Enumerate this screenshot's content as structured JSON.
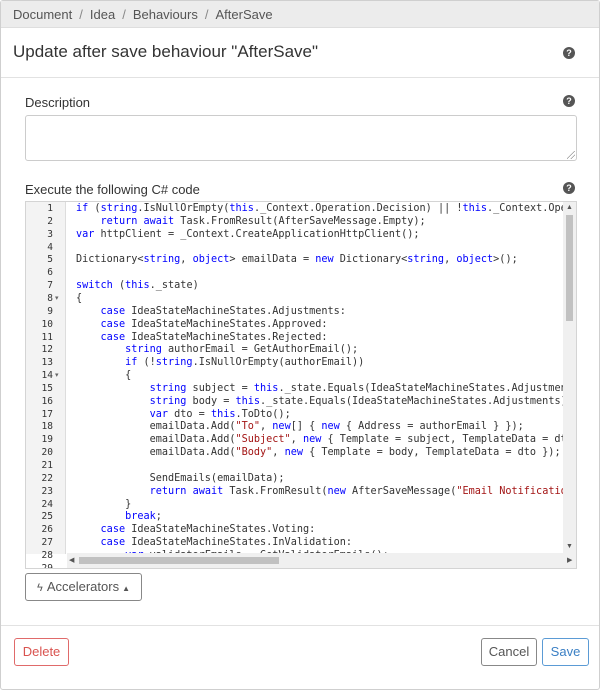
{
  "breadcrumb": [
    "Document",
    "Idea",
    "Behaviours",
    "AfterSave"
  ],
  "dialog": {
    "title": "Update after save behaviour \"AfterSave\""
  },
  "description": {
    "label": "Description",
    "value": ""
  },
  "code": {
    "label": "Execute the following C# code",
    "fold_lines": [
      8,
      14
    ],
    "lines": [
      "if (string.IsNullOrEmpty(this._Context.Operation.Decision) || !this._Context.Operation.",
      "    return await Task.FromResult(AfterSaveMessage.Empty);",
      "var httpClient = _Context.CreateApplicationHttpClient();",
      "",
      "Dictionary<string, object> emailData = new Dictionary<string, object>();",
      "",
      "switch (this._state)",
      "{",
      "    case IdeaStateMachineStates.Adjustments:",
      "    case IdeaStateMachineStates.Approved:",
      "    case IdeaStateMachineStates.Rejected:",
      "        string authorEmail = GetAuthorEmail();",
      "        if (!string.IsNullOrEmpty(authorEmail))",
      "        {",
      "            string subject = this._state.Equals(IdeaStateMachineStates.Adjustments) ?",
      "            string body = this._state.Equals(IdeaStateMachineStates.Adjustments) ? \"I",
      "            var dto = this.ToDto();",
      "            emailData.Add(\"To\", new[] { new { Address = authorEmail } });",
      "            emailData.Add(\"Subject\", new { Template = subject, TemplateData = dto });",
      "            emailData.Add(\"Body\", new { Template = body, TemplateData = dto });",
      "",
      "            SendEmails(emailData);",
      "            return await Task.FromResult(new AfterSaveMessage(\"Email Notifications se",
      "        }",
      "        break;",
      "    case IdeaStateMachineStates.Voting:",
      "    case IdeaStateMachineStates.InValidation:",
      "        var validatorEmails = GetValidatorEmails();",
      ""
    ]
  },
  "buttons": {
    "accelerators": "Accelerators",
    "delete": "Delete",
    "cancel": "Cancel",
    "save": "Save"
  },
  "icons": {
    "help": "question-circle-icon",
    "bolt": "bolt-icon",
    "caret": "caret-down-icon"
  },
  "colors": {
    "keyword": "#0000ff",
    "string": "#a31515",
    "delete": "#d9534f",
    "save": "#3a7fc4"
  }
}
